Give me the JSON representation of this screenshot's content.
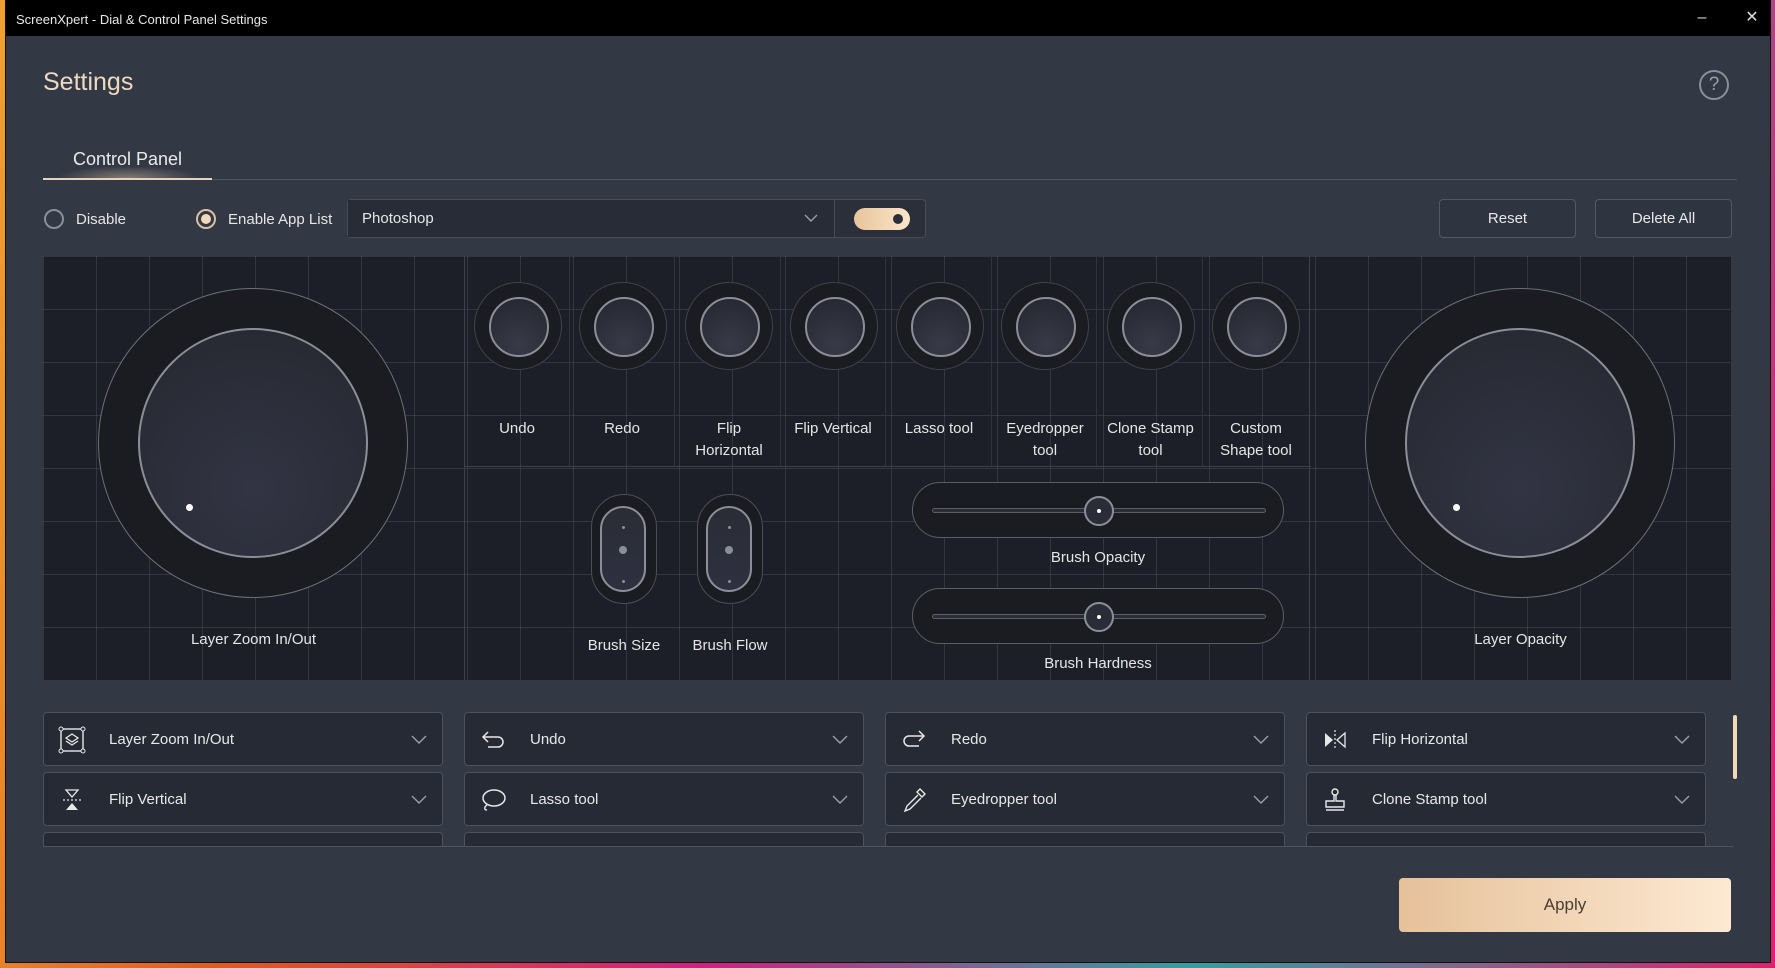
{
  "window": {
    "title": "ScreenXpert - Dial & Control Panel Settings",
    "minimize_glyph": "–",
    "close_glyph": "✕"
  },
  "header": {
    "title": "Settings",
    "help_glyph": "?"
  },
  "tabs": [
    {
      "label": "Control Panel",
      "active": true
    }
  ],
  "mode": {
    "options": [
      {
        "label": "Disable",
        "selected": false
      },
      {
        "label": "Enable App List",
        "selected": true
      }
    ],
    "app_select": {
      "value": "Photoshop"
    },
    "app_toggle_on": true
  },
  "actions": {
    "reset_label": "Reset",
    "delete_all_label": "Delete All",
    "apply_label": "Apply"
  },
  "panel": {
    "left_dial": {
      "label": "Layer Zoom In/Out"
    },
    "right_dial": {
      "label": "Layer Opacity"
    },
    "buttons": [
      {
        "label": "Undo"
      },
      {
        "label": "Redo"
      },
      {
        "label": "Flip Horizontal"
      },
      {
        "label": "Flip Vertical"
      },
      {
        "label": "Lasso tool"
      },
      {
        "label": "Eyedropper tool"
      },
      {
        "label": "Clone Stamp tool"
      },
      {
        "label": "Custom Shape tool"
      }
    ],
    "rockers": [
      {
        "label": "Brush Size"
      },
      {
        "label": "Brush Flow"
      }
    ],
    "sliders": [
      {
        "label": "Brush Opacity",
        "value_fraction": 0.5
      },
      {
        "label": "Brush Hardness",
        "value_fraction": 0.5
      }
    ]
  },
  "assignments": [
    {
      "label": "Layer Zoom In/Out",
      "icon": "layer-zoom-icon"
    },
    {
      "label": "Undo",
      "icon": "undo-icon"
    },
    {
      "label": "Redo",
      "icon": "redo-icon"
    },
    {
      "label": "Flip Horizontal",
      "icon": "flip-horizontal-icon"
    },
    {
      "label": "Flip Vertical",
      "icon": "flip-vertical-icon"
    },
    {
      "label": "Lasso tool",
      "icon": "lasso-icon"
    },
    {
      "label": "Eyedropper tool",
      "icon": "eyedropper-icon"
    },
    {
      "label": "Clone Stamp tool",
      "icon": "clone-stamp-icon"
    }
  ],
  "colors": {
    "accent": "#f3d9b8",
    "window_bg": "#323844",
    "panel_bg": "#1c1f27"
  }
}
